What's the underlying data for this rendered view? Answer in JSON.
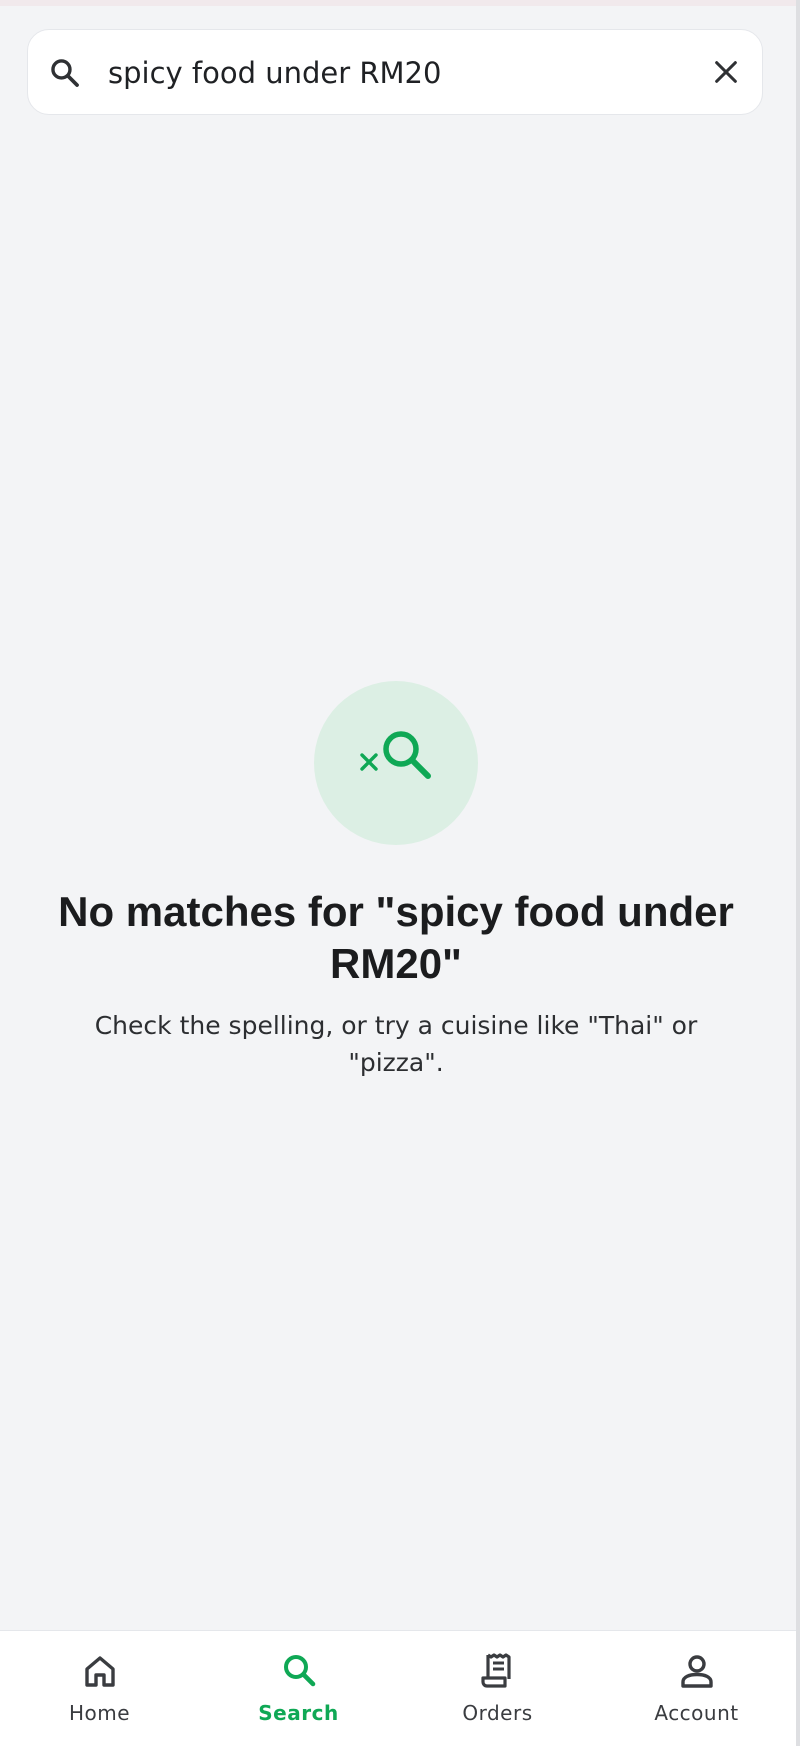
{
  "search": {
    "query": "spicy food under RM20"
  },
  "empty_state": {
    "icon": "search-off-icon",
    "title": "No matches for \"spicy food under RM20\"",
    "subtitle": "Check the spelling, or try a cuisine like \"Thai\" or \"pizza\"."
  },
  "bottom_nav": {
    "items": [
      {
        "label": "Home",
        "icon": "home-icon",
        "active": false
      },
      {
        "label": "Search",
        "icon": "search-icon",
        "active": true
      },
      {
        "label": "Orders",
        "icon": "receipt-icon",
        "active": false
      },
      {
        "label": "Account",
        "icon": "person-icon",
        "active": false
      }
    ]
  },
  "colors": {
    "accent": "#0fa855",
    "accent_soft": "#dcefe4",
    "background": "#f3f4f6",
    "text_primary": "#1b1c1e",
    "icon_default": "#3a3c40"
  }
}
